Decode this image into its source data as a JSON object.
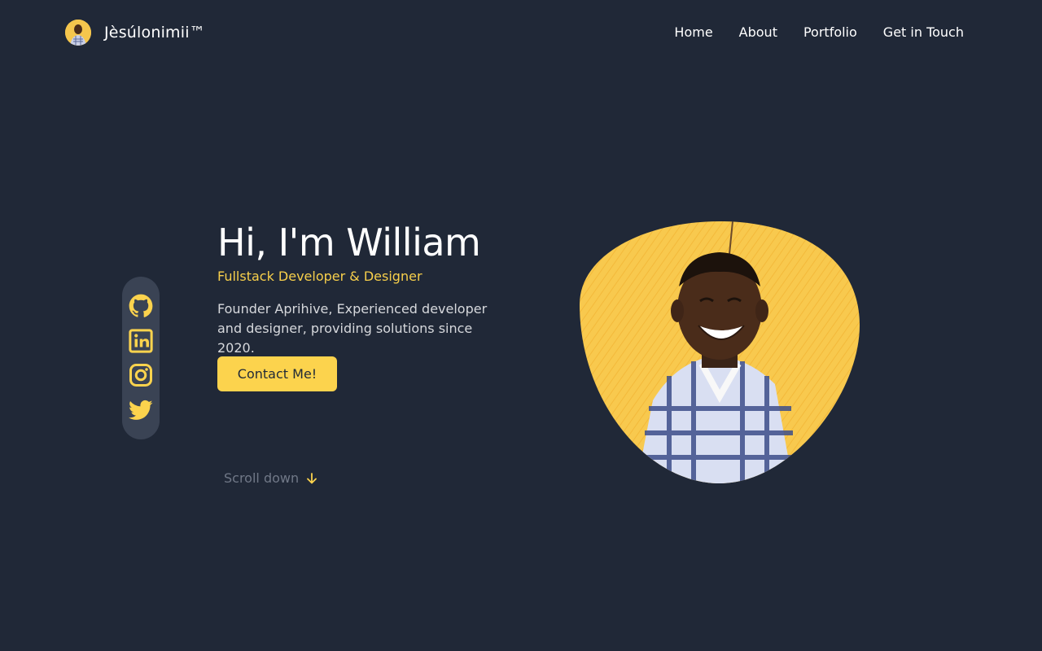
{
  "header": {
    "brand_name": "Jèsúlonimii™",
    "nav": [
      {
        "label": "Home"
      },
      {
        "label": "About"
      },
      {
        "label": "Portfolio"
      },
      {
        "label": "Get in Touch"
      }
    ]
  },
  "social": [
    {
      "icon": "github-icon"
    },
    {
      "icon": "linkedin-icon"
    },
    {
      "icon": "instagram-icon"
    },
    {
      "icon": "twitter-icon"
    }
  ],
  "hero": {
    "title": "Hi, I'm William",
    "role": "Fullstack Developer & Designer",
    "description": "Founder Aprihive, Experienced developer and designer, providing solutions since 2020.",
    "cta_label": "Contact Me!",
    "scroll_label": "Scroll down"
  },
  "colors": {
    "background": "#202837",
    "accent": "#fcd34d",
    "sidebar": "#3a4354",
    "muted_text": "#707887"
  }
}
